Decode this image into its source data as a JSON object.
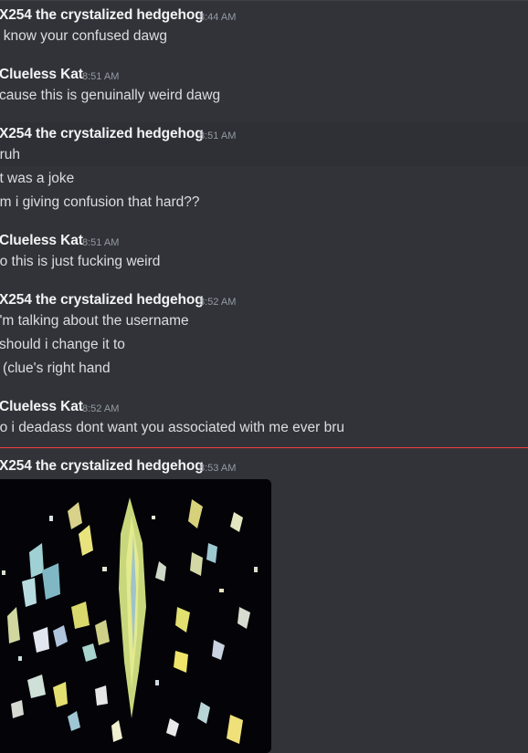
{
  "colors": {
    "background": "#313338",
    "hover_row": "#2e3035",
    "author": "#f2f3f5",
    "message_text": "#dbdee1",
    "timestamp": "#949ba4",
    "new_messages_divider": "#f23f43"
  },
  "messages": [
    {
      "author": "X254 the crystalized hedgehog",
      "timestamp": "8:44 AM",
      "lines": [
        "i know your confused dawg"
      ]
    },
    {
      "author": "Clueless Kat",
      "timestamp": "8:51 AM",
      "lines": [
        "cause this is genuinally weird dawg"
      ]
    },
    {
      "author": "X254 the crystalized hedgehog",
      "timestamp": "8:51 AM",
      "lines": [
        "bruh",
        "it was a joke",
        "am i giving confusion that hard??"
      ]
    },
    {
      "author": "Clueless Kat",
      "timestamp": "8:51 AM",
      "lines": [
        "no this is just fucking weird"
      ]
    },
    {
      "author": "X254 the crystalized hedgehog",
      "timestamp": "8:52 AM",
      "lines": [
        "i'm talking about the username",
        "should i change it to",
        "x (clue's right hand"
      ]
    },
    {
      "author": "Clueless Kat",
      "timestamp": "8:52 AM",
      "lines": [
        "no i deadass dont want you associated with me ever bru"
      ]
    },
    {
      "author": "X254 the crystalized hedgehog",
      "timestamp": "8:53 AM",
      "attachment": "image-attachment",
      "lines": []
    }
  ]
}
